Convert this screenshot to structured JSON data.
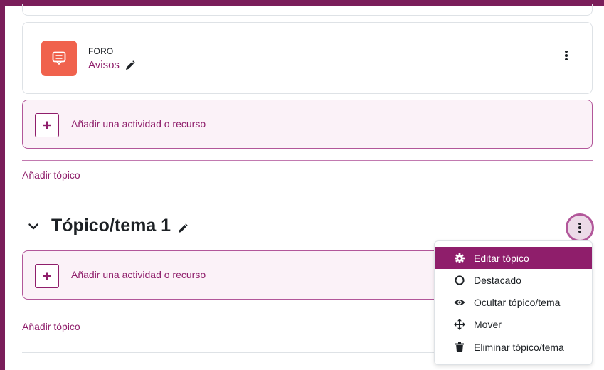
{
  "activity": {
    "type_label": "FORO",
    "name": "Avisos",
    "icon": "forum-icon",
    "edit_icon": "pencil-icon",
    "menu_icon": "kebab-icon"
  },
  "add_activity": [
    {
      "label": "Añadir una actividad o recurso"
    },
    {
      "label": "Añadir una actividad o recurso"
    }
  ],
  "add_topic": [
    {
      "label": "Añadir tópico"
    },
    {
      "label": "Añadir tópico"
    }
  ],
  "section": {
    "title": "Tópico/tema 1",
    "collapse_icon": "chevron-down-icon",
    "edit_icon": "pencil-icon",
    "menu_icon": "kebab-icon"
  },
  "section_menu": {
    "items": [
      {
        "label": "Editar tópico",
        "icon": "gear-icon",
        "active": true
      },
      {
        "label": "Destacado",
        "icon": "circle-icon",
        "active": false
      },
      {
        "label": "Ocultar tópico/tema",
        "icon": "eye-icon",
        "active": false
      },
      {
        "label": "Mover",
        "icon": "move-icon",
        "active": false
      },
      {
        "label": "Eliminar tópico/tema",
        "icon": "trash-icon",
        "active": false
      }
    ]
  },
  "colors": {
    "brand": "#8f1e6b",
    "frame": "#7a1e5a",
    "forum_icon_bg": "#f0624d",
    "add_box_bg": "#fbf2f8"
  }
}
